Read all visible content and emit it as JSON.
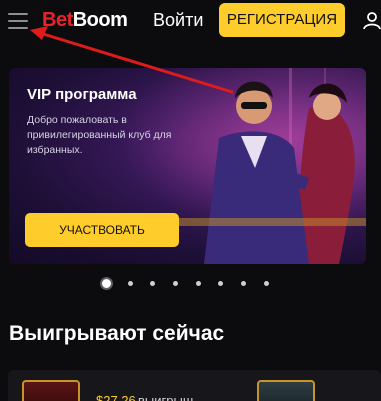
{
  "header": {
    "logo_part1": "Bet",
    "logo_part2": "Boom",
    "login_label": "Войти",
    "register_label": "РЕГИСТРАЦИЯ"
  },
  "banner": {
    "title": "VIP программа",
    "text": "Добро пожаловать в привилегированный клуб для избранных.",
    "cta_label": "УЧАСТВОВАТЬ"
  },
  "carousel": {
    "slide_count": 8,
    "active_index": 0
  },
  "section": {
    "title": "Выигрывают сейчас"
  },
  "winners": [
    {
      "amount": "$27.26",
      "label": "выигрыш"
    }
  ],
  "colors": {
    "accent": "#ffcd2b",
    "brand_red": "#e8232a",
    "background": "#0c0c0e",
    "annotation_arrow": "#e01b1b"
  },
  "icons": [
    "hamburger-menu-icon",
    "user-icon"
  ]
}
